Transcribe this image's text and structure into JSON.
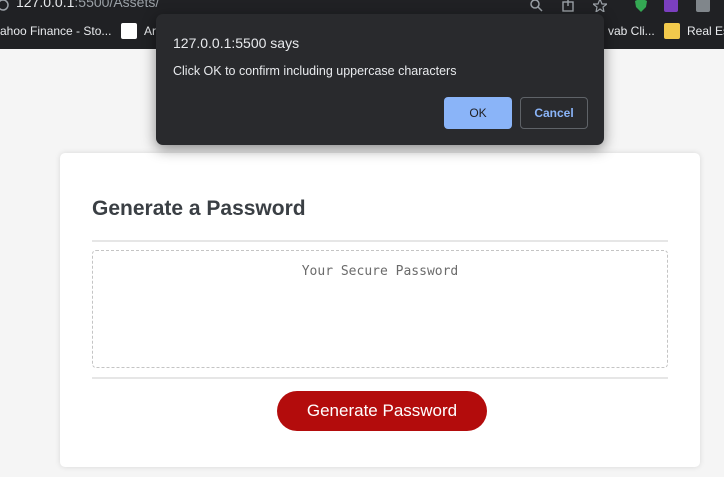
{
  "browser": {
    "url_host": "127.0.0.1",
    "url_rest": ":5500/Assets/",
    "bookmarks": [
      {
        "label": "ahoo Finance - Sto...",
        "icon": "yahoo-finance-icon"
      },
      {
        "label": "Ar",
        "icon": "amazon-icon"
      },
      {
        "label": "vab Cli...",
        "icon": "schwab-icon"
      },
      {
        "label": "Real Es",
        "icon": "folder-icon"
      }
    ]
  },
  "dialog": {
    "title": "127.0.0.1:5500 says",
    "message": "Click OK to confirm including uppercase characters",
    "ok_label": "OK",
    "cancel_label": "Cancel"
  },
  "card": {
    "title": "Generate a Password",
    "password_placeholder": "Your Secure Password",
    "generate_label": "Generate Password"
  },
  "colors": {
    "accent_button": "#b30c0c",
    "dialog_ok": "#8ab4f8",
    "dialog_bg": "#292a2d"
  }
}
